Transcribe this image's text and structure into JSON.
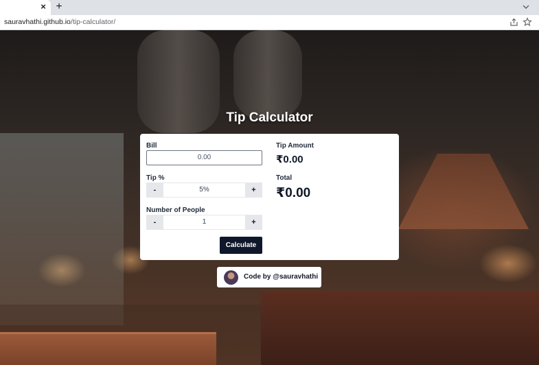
{
  "browser": {
    "tab_close": "×",
    "new_tab": "+",
    "url_host": "sauravhathi.github.io",
    "url_path": "/tip-calculator/"
  },
  "app": {
    "title": "Tip Calculator",
    "bill": {
      "label": "Bill",
      "value": "0.00"
    },
    "tip": {
      "label": "Tip %",
      "minus": "-",
      "value": "5%",
      "plus": "+"
    },
    "people": {
      "label": "Number of People",
      "minus": "-",
      "value": "1",
      "plus": "+"
    },
    "calculate_label": "Calculate",
    "tip_amount": {
      "label": "Tip Amount",
      "value": "₹0.00"
    },
    "total": {
      "label": "Total",
      "value": "₹0.00"
    }
  },
  "credit": {
    "text": "Code by  @sauravhathi"
  },
  "colors": {
    "button_dark": "#0f172a",
    "stepper_gray": "#e5e7eb",
    "card_bg": "#ffffff"
  },
  "icons": {
    "share": "share-icon",
    "bookmark": "star-icon",
    "tab_menu": "chevron-down-icon"
  }
}
